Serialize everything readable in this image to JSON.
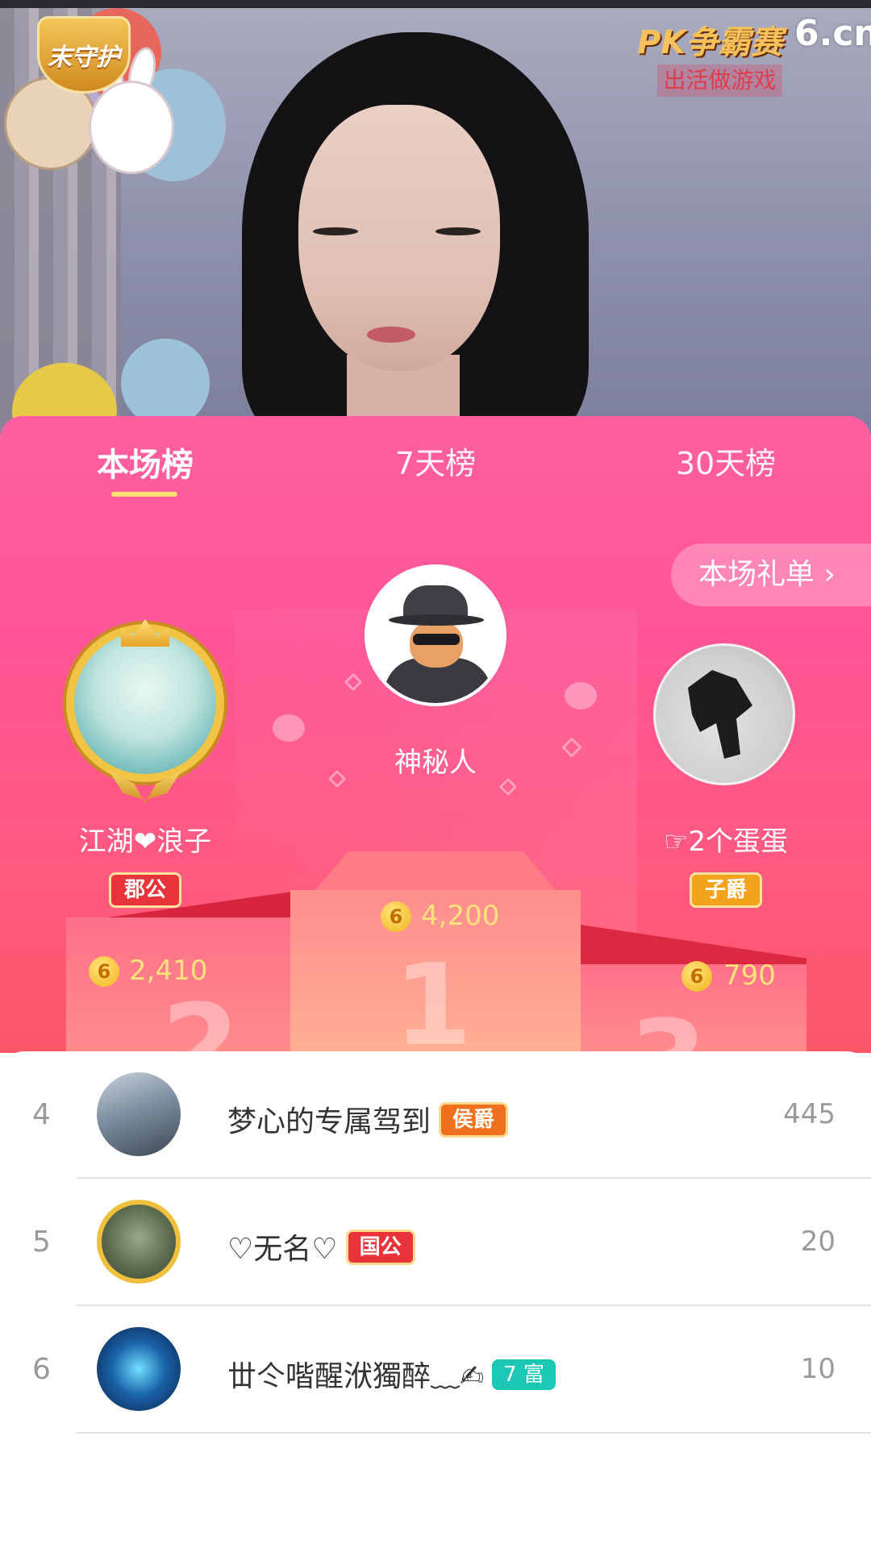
{
  "video": {
    "badge_text": "末守护",
    "pk_logo": "PK争霸赛",
    "pk_sub": "出活做游戏",
    "site_logo": "6.cn"
  },
  "tabs": [
    {
      "label": "本场榜",
      "active": true
    },
    {
      "label": "7天榜",
      "active": false
    },
    {
      "label": "30天榜",
      "active": false
    }
  ],
  "gift_list_button": "本场礼单 ›",
  "podium": {
    "first": {
      "rank": "1",
      "name": "神秘人",
      "score": "4,200",
      "coin": "6"
    },
    "second": {
      "rank": "2",
      "name": "江湖❤浪子",
      "badge": "郡公",
      "score": "2,410",
      "coin": "6"
    },
    "third": {
      "rank": "3",
      "name": "☞2个蛋蛋",
      "badge": "子爵",
      "score": "790",
      "coin": "6"
    }
  },
  "list": [
    {
      "rank": "4",
      "name": "梦心的专属驾到",
      "badge": "侯爵",
      "badge_color": "#f0701d",
      "value": "445"
    },
    {
      "rank": "5",
      "name": "♡无名♡",
      "badge": "国公",
      "badge_color": "#e8333a",
      "value": "20"
    },
    {
      "rank": "6",
      "name": "丗仒喈醒洑獨醉﹏✍",
      "badge": "7 富",
      "badge_color": "#1dc7b5",
      "value": "10"
    }
  ],
  "colors": {
    "panel_top": "#ff5fa0",
    "panel_bottom": "#f95868",
    "tab_underline": "#ffe074",
    "score_yellow": "#ffe27b"
  }
}
